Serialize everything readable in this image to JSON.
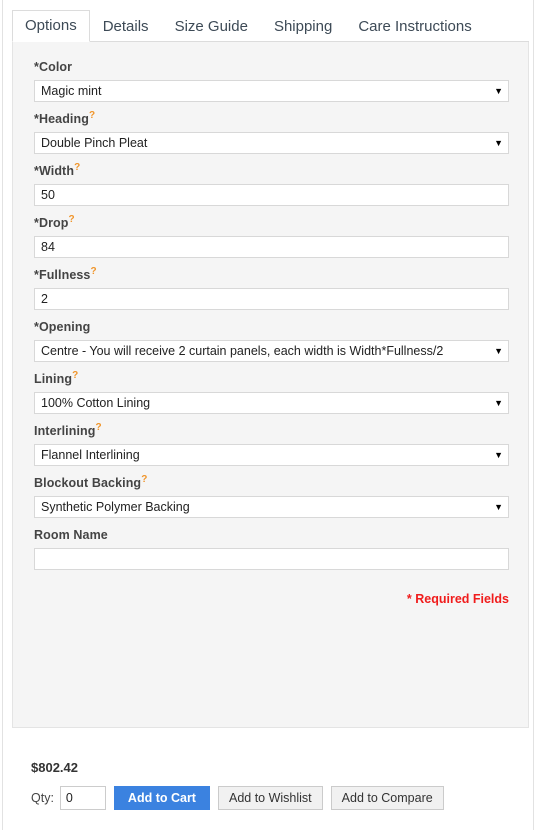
{
  "tabs": [
    {
      "label": "Options",
      "active": true
    },
    {
      "label": "Details",
      "active": false
    },
    {
      "label": "Size Guide",
      "active": false
    },
    {
      "label": "Shipping",
      "active": false
    },
    {
      "label": "Care Instructions",
      "active": false
    }
  ],
  "options_form": {
    "fields": [
      {
        "label": "*Color",
        "help": "",
        "type": "select",
        "value": "Magic mint"
      },
      {
        "label": "*Heading",
        "help": "?",
        "type": "select",
        "value": "Double Pinch Pleat"
      },
      {
        "label": "*Width",
        "help": "?",
        "type": "text",
        "value": "50"
      },
      {
        "label": "*Drop",
        "help": "?",
        "type": "text",
        "value": "84"
      },
      {
        "label": "*Fullness",
        "help": "?",
        "type": "text",
        "value": "2"
      },
      {
        "label": "*Opening",
        "help": "",
        "type": "select",
        "value": "Centre - You will receive 2 curtain panels, each width is Width*Fullness/2"
      },
      {
        "label": "Lining",
        "help": "?",
        "type": "select",
        "value": "100% Cotton Lining"
      },
      {
        "label": "Interlining",
        "help": "?",
        "type": "select",
        "value": "Flannel Interlining"
      },
      {
        "label": "Blockout Backing",
        "help": "?",
        "type": "select",
        "value": "Synthetic Polymer Backing"
      },
      {
        "label": "Room Name",
        "help": "",
        "type": "text",
        "value": ""
      }
    ],
    "required_note": "* Required Fields",
    "dropdown_glyph": "▼"
  },
  "purchase": {
    "price": "$802.42",
    "qty_label": "Qty:",
    "qty_value": "0",
    "add_to_cart_label": "Add to Cart",
    "add_to_wishlist_label": "Add to Wishlist",
    "add_to_compare_label": "Add to Compare"
  },
  "colors": {
    "primary_button": "#3b82e0",
    "required_red": "#f01c1c",
    "help_orange": "#f0952b",
    "panel_bg": "#f5f5f5"
  }
}
